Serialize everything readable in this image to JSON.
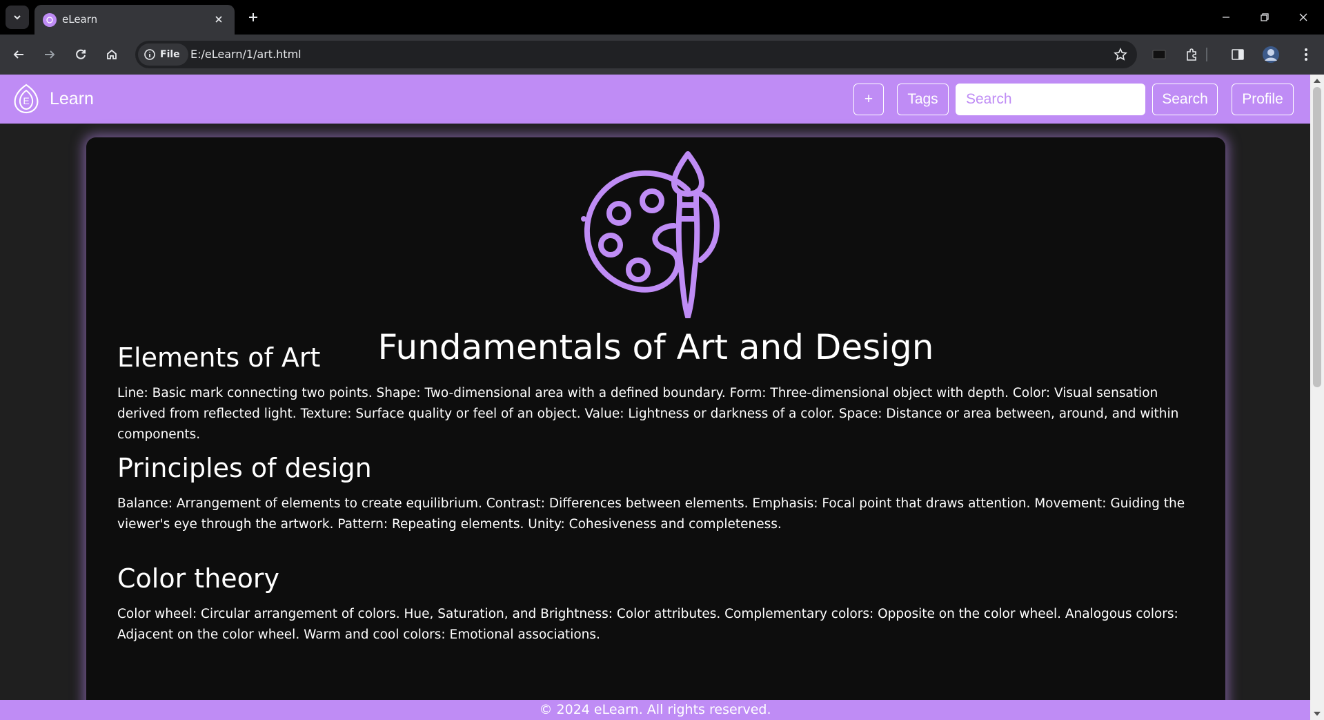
{
  "browser": {
    "tab_title": "eLearn",
    "url_chip": "File",
    "url": "E:/eLearn/1/art.html"
  },
  "navbar": {
    "brand": "Learn",
    "add_label": "+",
    "tags_label": "Tags",
    "search_placeholder": "Search",
    "search_label": "Search",
    "profile_label": "Profile"
  },
  "content": {
    "title": "Fundamentals of Art and Design",
    "sections": [
      {
        "heading": "Elements of Art",
        "body": "Line: Basic mark connecting two points. Shape: Two-dimensional area with a defined boundary. Form: Three-dimensional object with depth. Color: Visual sensation derived from reflected light. Texture: Surface quality or feel of an object. Value: Lightness or darkness of a color. Space: Distance or area between, around, and within components."
      },
      {
        "heading": "Principles of design",
        "body": "Balance: Arrangement of elements to create equilibrium. Contrast: Differences between elements. Emphasis: Focal point that draws attention. Movement: Guiding the viewer's eye through the artwork. Pattern: Repeating elements. Unity: Cohesiveness and completeness."
      },
      {
        "heading": "Color theory",
        "body": "Color wheel: Circular arrangement of colors. Hue, Saturation, and Brightness: Color attributes. Complementary colors: Opposite on the color wheel. Analogous colors: Adjacent on the color wheel. Warm and cool colors: Emotional associations."
      }
    ]
  },
  "footer": {
    "text": "© 2024 eLearn. All rights reserved."
  },
  "icons": {
    "hero": "palette-brush-icon",
    "brand": "elearn-logo"
  },
  "colors": {
    "accent": "#bf8cf5",
    "card_bg": "#0d0d0d",
    "page_bg": "#1f1f1f"
  }
}
